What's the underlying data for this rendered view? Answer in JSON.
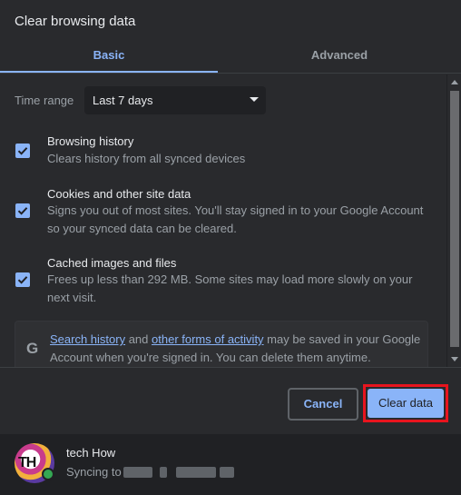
{
  "dialog": {
    "title": "Clear browsing data"
  },
  "tabs": [
    {
      "label": "Basic",
      "active": true
    },
    {
      "label": "Advanced",
      "active": false
    }
  ],
  "time_range": {
    "label": "Time range",
    "value": "Last 7 days"
  },
  "items": [
    {
      "title": "Browsing history",
      "description": "Clears history from all synced devices",
      "checked": true
    },
    {
      "title": "Cookies and other site data",
      "description": "Signs you out of most sites. You'll stay signed in to your Google Account so your synced data can be cleared.",
      "checked": true
    },
    {
      "title": "Cached images and files",
      "description": "Frees up less than 292 MB. Some sites may load more slowly on your next visit.",
      "checked": true
    }
  ],
  "info": {
    "link1": "Search history",
    "text1": " and ",
    "link2": "other forms of activity",
    "text2": " may be saved in your Google Account when you're signed in. You can delete them anytime."
  },
  "buttons": {
    "cancel": "Cancel",
    "clear": "Clear data"
  },
  "account": {
    "name": "tech How",
    "sync_prefix": "Syncing to",
    "avatar_letters": "TH"
  },
  "colors": {
    "accent": "#8ab4f8",
    "highlight": "#e8141e",
    "background": "#292a2d"
  }
}
